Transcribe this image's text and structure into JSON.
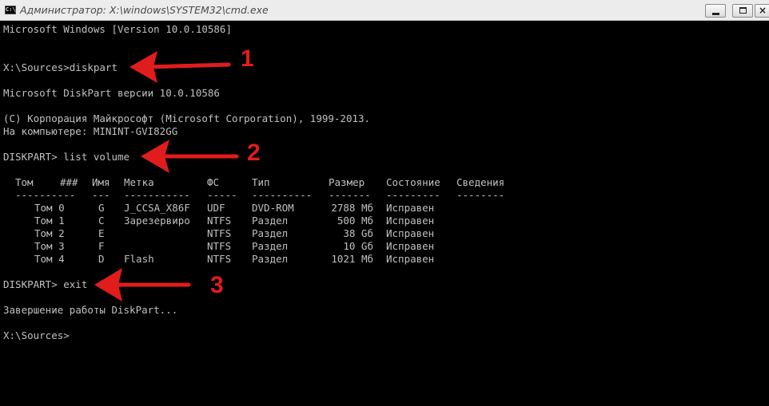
{
  "window": {
    "title": "Администратор: X:\\windows\\SYSTEM32\\cmd.exe",
    "icon": "console-app-icon",
    "icon_label": "C:\\",
    "buttons": [
      "minimize",
      "maximize",
      "close"
    ],
    "close_glyph": "×"
  },
  "console": {
    "lines": [
      "Microsoft Windows [Version 10.0.10586]",
      "X:\\Sources>diskpart",
      "Microsoft DiskPart версии 10.0.10586",
      "(C) Корпорация Майкрософт (Microsoft Corporation), 1999-2013.",
      "На компьютере: MININT-GVI82GG",
      "DISKPART> list volume",
      "DISKPART> exit",
      "Завершение работы DiskPart...",
      "X:\\Sources>"
    ],
    "volume_table": {
      "headers": [
        "Том",
        "###",
        "Имя",
        "Метка",
        "ФС",
        "Тип",
        "Размер",
        "Состояние",
        "Сведения"
      ],
      "separators": [
        "----------",
        "---",
        "-----------",
        "-----",
        "----------",
        "-------",
        "---------",
        "--------"
      ],
      "rows": [
        [
          "Том 0",
          "G",
          "J_CCSA_X86F",
          "UDF",
          "DVD-ROM",
          "2788 Мб",
          "Исправен",
          ""
        ],
        [
          "Том 1",
          "C",
          "Зарезервиро",
          "NTFS",
          "Раздел",
          "500 Мб",
          "Исправен",
          ""
        ],
        [
          "Том 2",
          "E",
          "",
          "NTFS",
          "Раздел",
          "38 Gб",
          "Исправен",
          ""
        ],
        [
          "Том 3",
          "F",
          "",
          "NTFS",
          "Раздел",
          "10 Gб",
          "Исправен",
          ""
        ],
        [
          "Том 4",
          "D",
          "Flash",
          "NTFS",
          "Раздел",
          "1021 Мб",
          "Исправен",
          ""
        ]
      ]
    }
  },
  "annotations": {
    "color": "#e11c1c",
    "numbers": [
      "1",
      "2",
      "3"
    ]
  }
}
